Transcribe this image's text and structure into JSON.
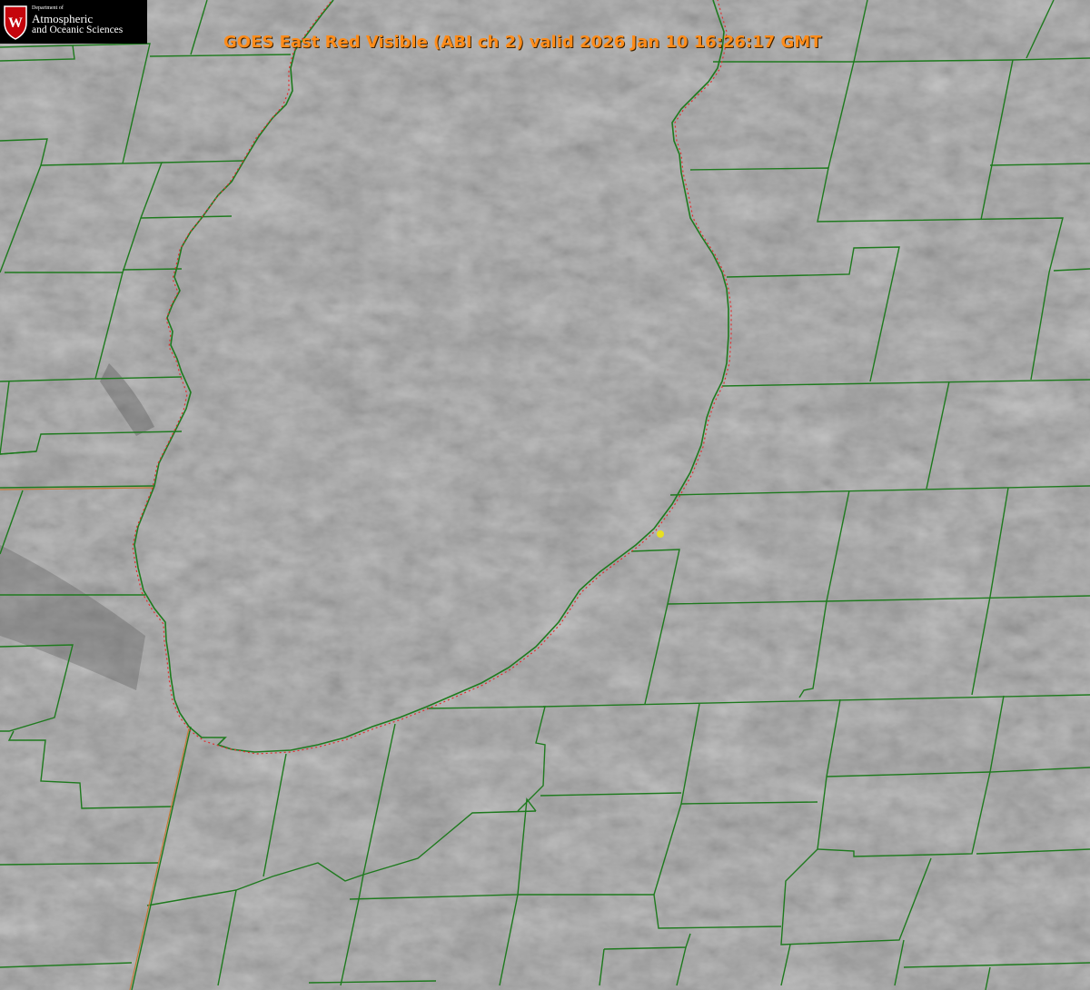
{
  "title": "GOES East Red Visible (ABI ch 2) valid 2026 Jan 10 16:26:17 GMT",
  "logo": {
    "seal_letter": "W",
    "department": "Department of",
    "line1": "Atmospheric",
    "line2": "and Oceanic Sciences"
  },
  "colors": {
    "county_lines": "#1e7a1e",
    "shoreline_overlay": "#e03030",
    "title_text": "#ff8c1a",
    "marker": "#e8e020",
    "logo_red": "#c5050c"
  },
  "map": {
    "imagery": "visible satellite cloud field",
    "features": [
      "lake",
      "county boundaries",
      "state boundary",
      "location marker"
    ]
  }
}
